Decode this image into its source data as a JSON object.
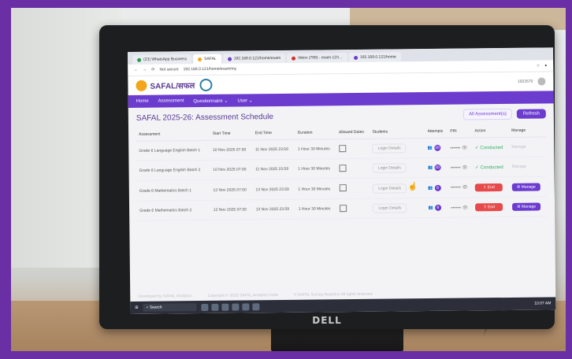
{
  "browser": {
    "tabs": [
      {
        "label": "(23) WhatsApp Business",
        "active": false
      },
      {
        "label": "SAFAL",
        "active": true
      },
      {
        "label": "192.168.0.121/home/exam",
        "active": false
      },
      {
        "label": "Inbox (789) - exam.123…",
        "active": false
      },
      {
        "label": "192.168.0.121/home",
        "active": false
      }
    ],
    "address": {
      "security_label": "Not secure",
      "url": "192.168.0.121/home/exam/my"
    }
  },
  "brand": {
    "name": "SAFAL/सफल",
    "right_text": "1923570"
  },
  "nav": {
    "items": [
      "Home",
      "Assessment",
      "Questionnaire ⌄",
      "User ⌄"
    ]
  },
  "page": {
    "title": "SAFAL 2025-26: Assessment Schedule",
    "filter_label": "All Assessment(s)",
    "refresh_label": "Refresh"
  },
  "table": {
    "headers": [
      "Assessment",
      "Start Time",
      "End Time",
      "Duration",
      "Allowed Dates",
      "Students",
      "Attempts",
      "PIN",
      "Action",
      "Manage"
    ],
    "rows": [
      {
        "assessment": "Grade 6 Language English Batch 1",
        "start": "10 Nov 2025 07:00",
        "end": "11 Nov 2025 23:59",
        "duration": "1 Hour 30 Minutes",
        "students": "Login Details",
        "attempts": "20",
        "pin": "•••••• 👁",
        "action": "Conducted",
        "manage": "Manage"
      },
      {
        "assessment": "Grade 6 Language English Batch 2",
        "start": "10 Nov 2025 07:00",
        "end": "11 Nov 2025 23:59",
        "duration": "1 Hour 30 Minutes",
        "students": "Login Details",
        "attempts": "20",
        "pin": "•••••• 👁",
        "action": "Conducted",
        "manage": "Manage"
      },
      {
        "assessment": "Grade 6 Mathematics Batch 1",
        "start": "12 Nov 2025 07:00",
        "end": "13 Nov 2025 23:59",
        "duration": "1 Hour 30 Minutes",
        "students": "Login Details",
        "attempts": "6",
        "pin": "•••••• 👁",
        "action": "End",
        "manage": "Manage"
      },
      {
        "assessment": "Grade 6 Mathematics Batch 2",
        "start": "12 Nov 2025 07:00",
        "end": "13 Nov 2025 23:59",
        "duration": "1 Hour 30 Minutes",
        "students": "Login Details",
        "attempts": "8",
        "pin": "•••••• 👁",
        "action": "End",
        "manage": "Manage"
      }
    ]
  },
  "footer": {
    "left": "Developed by SAFAL Analytics",
    "mid": "Copyright © 2025 SAFAL Analytics India",
    "right": "© SAFAL Survey Analytics All rights reserved"
  },
  "taskbar": {
    "search_placeholder": "Search",
    "clock": "10:07 AM"
  },
  "monitor": {
    "logo": "DELL"
  },
  "icons": {
    "back": "back-icon",
    "forward": "forward-icon",
    "reload": "reload-icon",
    "star": "star-icon",
    "profile": "profile-icon",
    "calendar": "calendar-icon",
    "eye": "eye-icon",
    "check": "check-circle-icon",
    "upload": "upload-icon",
    "gear": "gear-icon",
    "pointer": "hand-cursor-icon"
  }
}
